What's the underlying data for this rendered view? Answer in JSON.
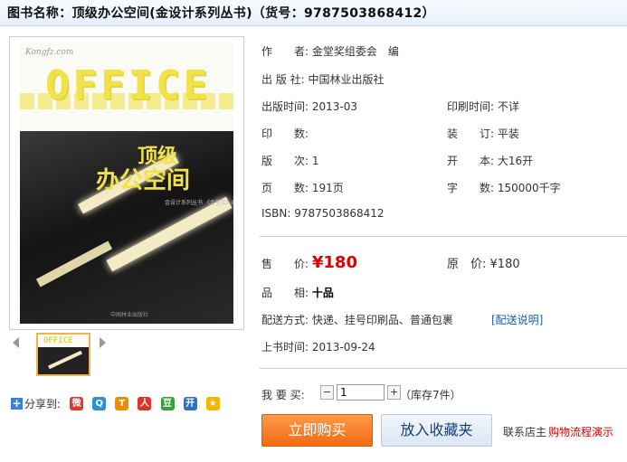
{
  "header": {
    "title": "图书名称：顶级办公空间(金设计系列丛书)（货号：9787503868412）"
  },
  "cover": {
    "logo": "Kongfz.com",
    "office_word": "OFFICE",
    "zh_line1": "顶级",
    "zh_line2": "办公空间",
    "subtitle": "金设计系列丛书 《金堂奖》组委会 编",
    "publisher": "中国林业出版社"
  },
  "thumbnail": {
    "word": "OFFICE"
  },
  "share": {
    "label": "分享到:",
    "icons": [
      "weibo-icon",
      "qzone-icon",
      "tencent-weibo-icon",
      "renren-icon",
      "douban-icon",
      "kaixin-icon",
      "favorite-icon"
    ]
  },
  "info": {
    "author_label": "作　　者:",
    "author": "金堂奖组委会　编",
    "publisher_label": "出 版 社:",
    "publisher": "中国林业出版社",
    "pubdate_label": "出版时间:",
    "pubdate": "2013-03",
    "printdate_label": "印刷时间:",
    "printdate": "不详",
    "printing_label": "印　　数:",
    "printing": "",
    "binding_label": "装　　订:",
    "binding": "平装",
    "edition_label": "版　　次:",
    "edition": "1",
    "format_label": "开　　本:",
    "format": "大16开",
    "pages_label": "页　　数:",
    "pages": "191页",
    "words_label": "字　　数:",
    "words": "150000千字",
    "isbn_label": "ISBN:",
    "isbn": "9787503868412"
  },
  "pricing": {
    "sale_label": "售　　价:",
    "sale_price": "¥180",
    "orig_label": "原　价:",
    "orig_price": "¥180",
    "condition_label": "品　　相:",
    "condition": "十品",
    "shipping_label": "配送方式:",
    "shipping": "快递、挂号印刷品、普通包裹",
    "shipping_link": "[配送说明]",
    "listed_label": "上书时间:",
    "listed": "2013-09-24"
  },
  "purchase": {
    "qty_label": "我 要 买:",
    "minus": "−",
    "plus": "+",
    "qty": "1",
    "stock": "（库存7件）",
    "buy_button": "立即购买",
    "fav_button": "放入收藏夹",
    "contact": "联系店主",
    "flow_link": "购物流程演示"
  },
  "colors": {
    "accent": "#f26b12",
    "price": "#dd0000",
    "link": "#1a5ba8"
  }
}
